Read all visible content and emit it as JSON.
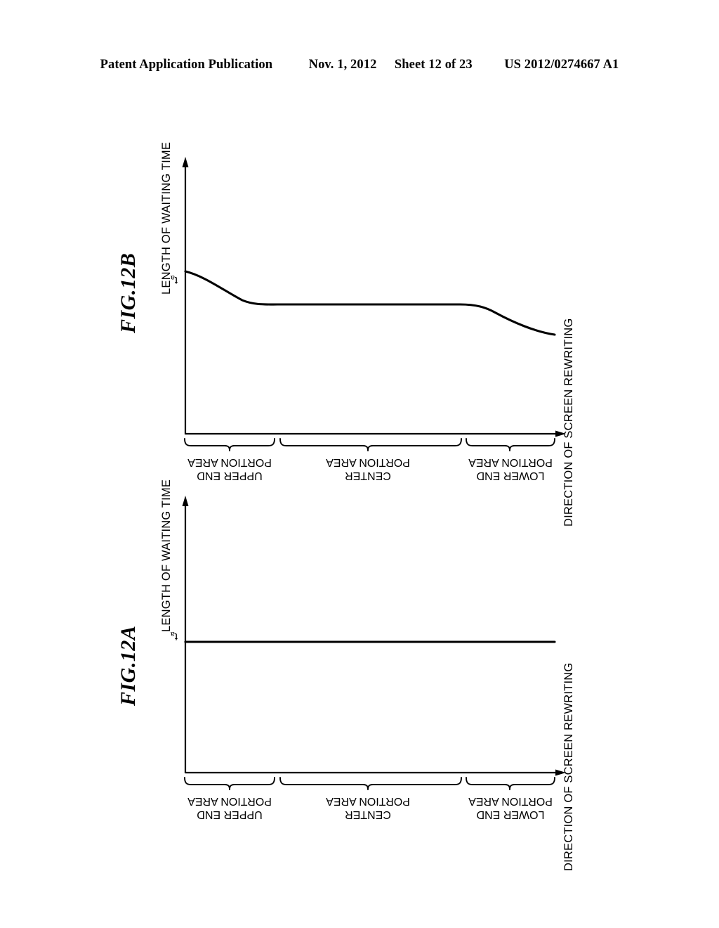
{
  "header": {
    "publication": "Patent Application Publication",
    "date": "Nov. 1, 2012",
    "sheet": "Sheet 12 of 23",
    "doc_number": "US 2012/0274667 A1"
  },
  "figures": [
    {
      "id": "fig-12b",
      "caption": "FIG.12B",
      "y_axis_label": "LENGTH OF WAITING TIME",
      "x_axis_label": "DIRECTION OF SCREEN REWRITING",
      "tick_label": "t",
      "tick_subscript": "a",
      "regions": [
        {
          "name": "upper-end-portion-area",
          "label": "UPPER END\nPORTION AREA"
        },
        {
          "name": "center-portion-area",
          "label": "CENTER\nPORTION AREA"
        },
        {
          "name": "lower-end-portion-area",
          "label": "LOWER END\nPORTION AREA"
        }
      ]
    },
    {
      "id": "fig-12a",
      "caption": "FIG.12A",
      "y_axis_label": "LENGTH OF WAITING TIME",
      "x_axis_label": "DIRECTION OF SCREEN REWRITING",
      "tick_label": "t",
      "tick_subscript": "a",
      "regions": [
        {
          "name": "upper-end-portion-area",
          "label": "UPPER END\nPORTION AREA"
        },
        {
          "name": "center-portion-area",
          "label": "CENTER\nPORTION AREA"
        },
        {
          "name": "lower-end-portion-area",
          "label": "LOWER END\nPORTION AREA"
        }
      ]
    }
  ],
  "chart_data": [
    {
      "type": "line",
      "id": "fig-12b",
      "title": "FIG.12B",
      "xlabel": "DIRECTION OF SCREEN REWRITING",
      "ylabel": "LENGTH OF WAITING TIME",
      "x_categories": [
        "UPPER END PORTION AREA",
        "CENTER PORTION AREA",
        "LOWER END PORTION AREA"
      ],
      "y_ticks": [
        "t_a"
      ],
      "grid": false,
      "legend": "none",
      "description": "Waiting time starts at t_a at the upper end, decays to a lower constant plateau across the center portion area, then falls off further toward the lower end.",
      "series": [
        {
          "name": "waiting time",
          "x": [
            0.0,
            0.05,
            0.1,
            0.15,
            0.2,
            0.25,
            0.3,
            0.4,
            0.5,
            0.6,
            0.7,
            0.78,
            0.85,
            0.9,
            0.95,
            1.0
          ],
          "y": [
            1.0,
            0.93,
            0.86,
            0.81,
            0.78,
            0.765,
            0.76,
            0.76,
            0.76,
            0.76,
            0.76,
            0.755,
            0.7,
            0.62,
            0.54,
            0.48
          ]
        }
      ]
    },
    {
      "type": "line",
      "id": "fig-12a",
      "title": "FIG.12A",
      "xlabel": "DIRECTION OF SCREEN REWRITING",
      "ylabel": "LENGTH OF WAITING TIME",
      "x_categories": [
        "UPPER END PORTION AREA",
        "CENTER PORTION AREA",
        "LOWER END PORTION AREA"
      ],
      "y_ticks": [
        "t_a"
      ],
      "grid": false,
      "legend": "none",
      "description": "Waiting time is constant at t_a across the entire screen rewriting direction.",
      "series": [
        {
          "name": "waiting time",
          "x": [
            0.0,
            1.0
          ],
          "y": [
            1.0,
            1.0
          ]
        }
      ]
    }
  ]
}
